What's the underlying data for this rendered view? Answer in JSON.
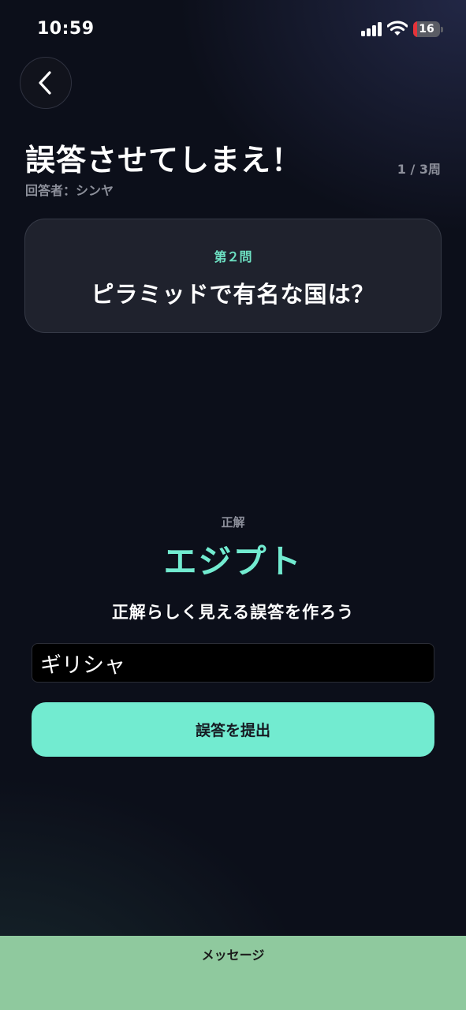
{
  "status_bar": {
    "time": "10:59",
    "battery": "16",
    "battery_level": 0.16
  },
  "header": {
    "title": "誤答させてしまえ！",
    "answerer": "回答者：シンヤ",
    "round": "1 / 3周"
  },
  "question": {
    "number": "第２問",
    "text": "ピラミッドで有名な国は？"
  },
  "answer": {
    "label": "正解",
    "correct": "エジプト",
    "instruction": "正解らしく見える誤答を作ろう",
    "input_value": "ギリシャ",
    "submit_label": "誤答を提出"
  },
  "message_bar": {
    "label": "メッセージ"
  },
  "colors": {
    "accent": "#72ebd0",
    "background": "#0c0f1a",
    "message_bar": "#8fc99e",
    "battery_low": "#e5333a"
  }
}
